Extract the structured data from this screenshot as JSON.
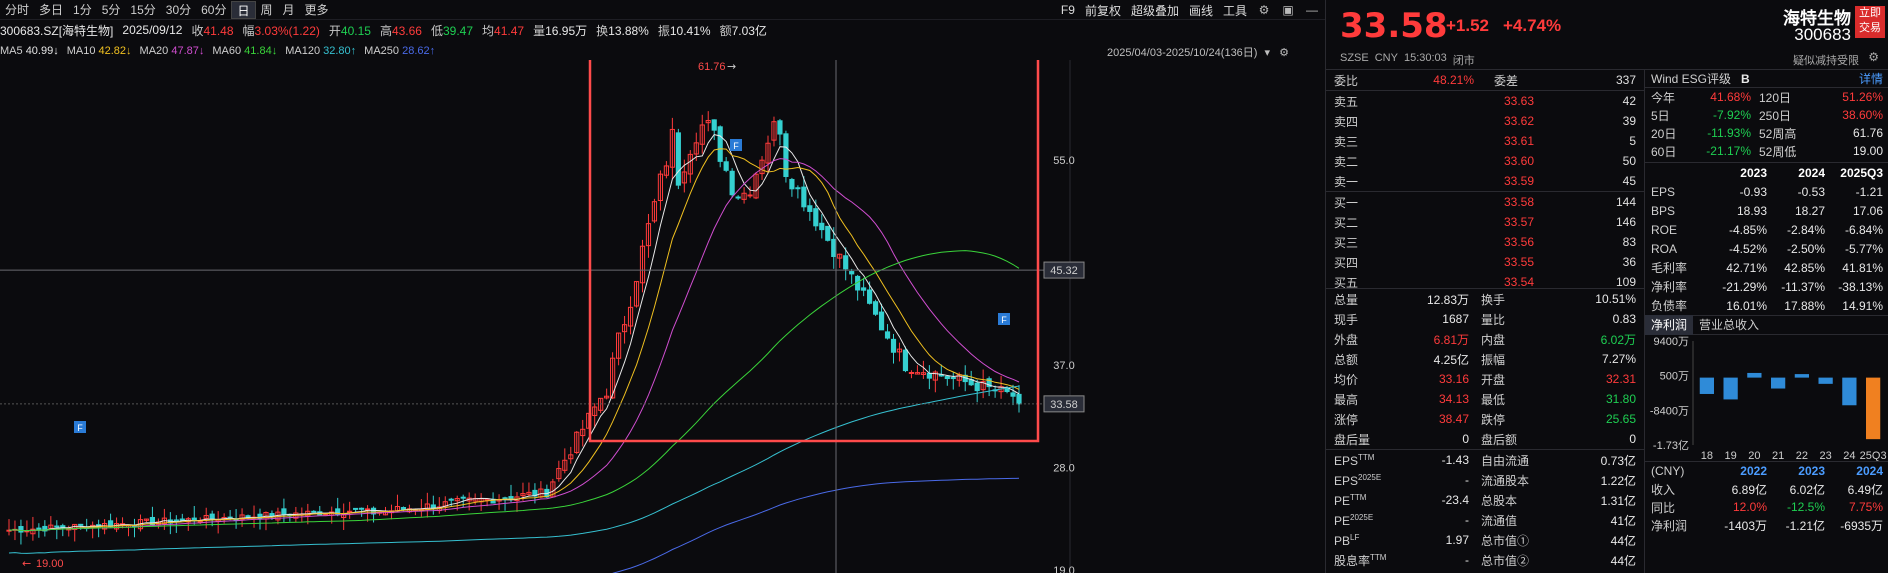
{
  "periods": [
    "分时",
    "多日",
    "1分",
    "5分",
    "15分",
    "30分",
    "60分",
    "日",
    "周",
    "月",
    "更多"
  ],
  "active_period": "日",
  "toolbar": [
    "F9",
    "前复权",
    "超级叠加",
    "画线",
    "工具"
  ],
  "quote": {
    "code": "300683.SZ[海特生物]",
    "date": "2025/09/12",
    "close_label": "收",
    "close": "41.48",
    "amp_label": "幅",
    "amp": "3.03%(1.22)",
    "open_label": "开",
    "open": "40.15",
    "high_label": "高",
    "high": "43.66",
    "low_label": "低",
    "low": "39.47",
    "avg_label": "均",
    "avg": "41.47",
    "vol_label": "量",
    "vol": "16.95万",
    "turn_label": "换",
    "turn": "13.88%",
    "swing_label": "振",
    "swing": "10.41%",
    "amt_label": "额",
    "amt": "7.03亿"
  },
  "ma": [
    {
      "label": "MA5",
      "value": "40.99",
      "color": "#e8e8e8"
    },
    {
      "label": "MA10",
      "value": "42.82",
      "color": "#f0c020"
    },
    {
      "label": "MA20",
      "value": "47.87",
      "color": "#d04ed0"
    },
    {
      "label": "MA60",
      "value": "41.84",
      "color": "#3ad43a"
    },
    {
      "label": "MA120",
      "value": "32.80",
      "color": "#36c0d0"
    },
    {
      "label": "MA250",
      "value": "28.62",
      "color": "#4a6ae8"
    }
  ],
  "range_label": "2025/04/03-2025/10/24(136日)",
  "chart": {
    "price_ticks": [
      "55.0",
      "45.32",
      "37.0",
      "33.58",
      "28.0",
      "19.0"
    ],
    "peak_label": "61.76",
    "low_label": "19.00",
    "marker_f": "F"
  },
  "chart_data": {
    "type": "candlestick",
    "title": "300683.SZ[海特生物]",
    "ylim": [
      19.0,
      62.0
    ],
    "yticks": [
      55.0,
      45.32,
      37.0,
      33.58,
      28.0,
      19.0
    ],
    "highlight_range": "2025/04/03-2025/10/24(136日)",
    "peak": 61.76,
    "low": 19.0,
    "last": 33.58
  },
  "header": {
    "price": "33.58",
    "change": "+1.52",
    "pct": "+4.74%",
    "name": "海特生物",
    "code": "300683",
    "trade_label": "立即交易",
    "exchange": "SZSE",
    "currency": "CNY",
    "time": "15:30:03",
    "status": "闭市",
    "tip": "疑似减持受限"
  },
  "orderbook": {
    "weibi_label": "委比",
    "weibi": "48.21%",
    "weicha_label": "委差",
    "weicha": "337",
    "asks": [
      {
        "label": "卖五",
        "price": "33.63",
        "vol": "42"
      },
      {
        "label": "卖四",
        "price": "33.62",
        "vol": "39"
      },
      {
        "label": "卖三",
        "price": "33.61",
        "vol": "5"
      },
      {
        "label": "卖二",
        "price": "33.60",
        "vol": "50"
      },
      {
        "label": "卖一",
        "price": "33.59",
        "vol": "45"
      }
    ],
    "bids": [
      {
        "label": "买一",
        "price": "33.58",
        "vol": "144"
      },
      {
        "label": "买二",
        "price": "33.57",
        "vol": "146"
      },
      {
        "label": "买三",
        "price": "33.56",
        "vol": "83"
      },
      {
        "label": "买四",
        "price": "33.55",
        "vol": "36"
      },
      {
        "label": "买五",
        "price": "33.54",
        "vol": "109"
      }
    ]
  },
  "stats": [
    [
      {
        "k": "总量",
        "v": "12.83万",
        "c": "white"
      },
      {
        "k": "换手",
        "v": "10.51%",
        "c": "white"
      }
    ],
    [
      {
        "k": "现手",
        "v": "1687",
        "c": "white"
      },
      {
        "k": "量比",
        "v": "0.83",
        "c": "white"
      }
    ],
    [
      {
        "k": "外盘",
        "v": "6.81万",
        "c": "red"
      },
      {
        "k": "内盘",
        "v": "6.02万",
        "c": "green"
      }
    ],
    [
      {
        "k": "总额",
        "v": "4.25亿",
        "c": "white"
      },
      {
        "k": "振幅",
        "v": "7.27%",
        "c": "white"
      }
    ],
    [
      {
        "k": "均价",
        "v": "33.16",
        "c": "red"
      },
      {
        "k": "开盘",
        "v": "32.31",
        "c": "red"
      }
    ],
    [
      {
        "k": "最高",
        "v": "34.13",
        "c": "red"
      },
      {
        "k": "最低",
        "v": "31.80",
        "c": "green"
      }
    ],
    [
      {
        "k": "涨停",
        "v": "38.47",
        "c": "red"
      },
      {
        "k": "跌停",
        "v": "25.65",
        "c": "green"
      }
    ],
    [
      {
        "k": "盘后量",
        "v": "0",
        "c": "white"
      },
      {
        "k": "盘后额",
        "v": "0",
        "c": "white"
      }
    ]
  ],
  "fundamentals": [
    [
      {
        "k": "EPS",
        "sup": "TTM",
        "v": "-1.43"
      },
      {
        "k": "自由流通",
        "sup": "",
        "v": "0.73亿"
      }
    ],
    [
      {
        "k": "EPS",
        "sup": "2025E",
        "v": "-"
      },
      {
        "k": "流通股本",
        "sup": "",
        "v": "1.22亿"
      }
    ],
    [
      {
        "k": "PE",
        "sup": "TTM",
        "v": "-23.4"
      },
      {
        "k": "总股本",
        "sup": "",
        "v": "1.31亿"
      }
    ],
    [
      {
        "k": "PE",
        "sup": "2025E",
        "v": "-"
      },
      {
        "k": "流通值",
        "sup": "",
        "v": "41亿"
      }
    ],
    [
      {
        "k": "PB",
        "sup": "LF",
        "v": "1.97"
      },
      {
        "k": "总市值①",
        "sup": "",
        "v": "44亿"
      }
    ],
    [
      {
        "k": "股息率",
        "sup": "TTM",
        "v": "-"
      },
      {
        "k": "总市值②",
        "sup": "",
        "v": "44亿"
      }
    ]
  ],
  "wind": {
    "title": "Wind ESG评级",
    "grade": "B",
    "detail": "详情",
    "perf": [
      {
        "a": "今年",
        "b": "41.68%",
        "bc": "red",
        "c": "120日",
        "d": "51.26%",
        "dc": "red"
      },
      {
        "a": "5日",
        "b": "-7.92%",
        "bc": "green",
        "c": "250日",
        "d": "38.60%",
        "dc": "red"
      },
      {
        "a": "20日",
        "b": "-11.93%",
        "bc": "green",
        "c": "52周高",
        "d": "61.76",
        "dc": "white"
      },
      {
        "a": "60日",
        "b": "-21.17%",
        "bc": "green",
        "c": "52周低",
        "d": "19.00",
        "dc": "white"
      }
    ],
    "fin_head": [
      "2023",
      "2024",
      "2025Q3"
    ],
    "fin": [
      {
        "n": "EPS",
        "v": [
          "-0.93",
          "-0.53",
          "-1.21"
        ]
      },
      {
        "n": "BPS",
        "v": [
          "18.93",
          "18.27",
          "17.06"
        ]
      },
      {
        "n": "ROE",
        "v": [
          "-4.85%",
          "-2.84%",
          "-6.84%"
        ]
      },
      {
        "n": "ROA",
        "v": [
          "-4.52%",
          "-2.50%",
          "-5.77%"
        ]
      },
      {
        "n": "毛利率",
        "v": [
          "42.71%",
          "42.85%",
          "41.81%"
        ]
      },
      {
        "n": "净利率",
        "v": [
          "-21.29%",
          "-11.37%",
          "-38.13%"
        ]
      },
      {
        "n": "负债率",
        "v": [
          "16.01%",
          "17.88%",
          "14.91%"
        ]
      }
    ],
    "tabs": [
      "净利润",
      "营业总收入"
    ],
    "bar_yticks": [
      "9400万",
      "500万",
      "-8400万",
      "-1.73亿"
    ],
    "bar_xticks": [
      "18",
      "19",
      "20",
      "21",
      "22",
      "23",
      "24",
      "25Q3"
    ],
    "bar_values": [
      -4200,
      -5600,
      1200,
      -2800,
      900,
      -1600,
      -7100,
      -15800
    ],
    "rev_head_label": "(CNY)",
    "rev_head": [
      "2022",
      "2023",
      "2024"
    ],
    "rev": [
      {
        "n": "收入",
        "v": [
          "6.89亿",
          "6.02亿",
          "6.49亿"
        ],
        "c": [
          "white",
          "white",
          "white"
        ]
      },
      {
        "n": "同比",
        "v": [
          "12.0%",
          "-12.5%",
          "7.75%"
        ],
        "c": [
          "red",
          "green",
          "red"
        ]
      },
      {
        "n": "净利润",
        "v": [
          "-1403万",
          "-1.21亿",
          "-6935万"
        ],
        "c": [
          "white",
          "white",
          "white"
        ]
      }
    ]
  }
}
